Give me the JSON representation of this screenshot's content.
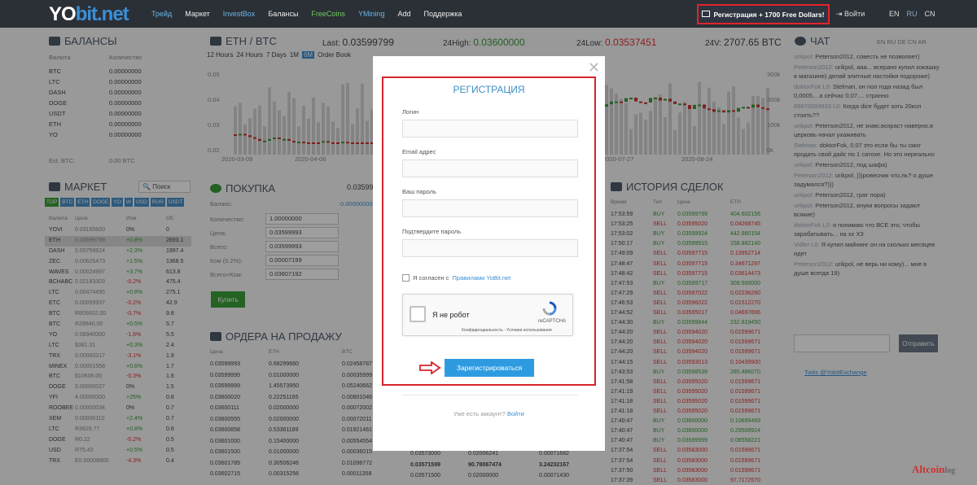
{
  "nav": {
    "logo_a": "YO",
    "logo_b": "bit.net",
    "links": [
      {
        "label": "Трейд",
        "style": "hl"
      },
      {
        "label": "Маркет",
        "style": ""
      },
      {
        "label": "InvestBox",
        "style": "hl"
      },
      {
        "label": "Балансы",
        "style": ""
      },
      {
        "label": "FreeCoins",
        "style": "gr"
      },
      {
        "label": "YMining",
        "style": "hl"
      },
      {
        "label": "Add",
        "style": ""
      },
      {
        "label": "Поддержка",
        "style": ""
      }
    ],
    "register_label": "Регистрация + 1700 Free Dollars!",
    "login_label": "Войти",
    "langs": [
      "EN",
      "RU",
      "CN"
    ]
  },
  "balances": {
    "title": "БАЛАНСЫ",
    "col_currency": "Валюта",
    "col_amount": "Количество",
    "rows": [
      {
        "cur": "BTC",
        "amt": "0.00000000"
      },
      {
        "cur": "LTC",
        "amt": "0.00000000"
      },
      {
        "cur": "DASH",
        "amt": "0.00000000"
      },
      {
        "cur": "DOGE",
        "amt": "0.00000000"
      },
      {
        "cur": "USDT",
        "amt": "0.00000000"
      },
      {
        "cur": "ETH",
        "amt": "0.00000000"
      },
      {
        "cur": "YO",
        "amt": "0.00000000"
      }
    ],
    "est_label": "Est. BTC:",
    "est_value": "0.00 BTC"
  },
  "pair": {
    "name": "ETH / BTC",
    "last_label": "Last:",
    "last": "0.03599799",
    "high_label": "24High:",
    "high": "0.03600000",
    "low_label": "24Low:",
    "low": "0.03537451",
    "vol_label": "24V:",
    "vol": "2707.65 BTC",
    "ranges": [
      "12 Hours",
      "24 Hours",
      "7 Days",
      "1M",
      "6M",
      "Order Book"
    ],
    "y_left": [
      "0.05",
      "0.04",
      "0.03",
      "0.02"
    ],
    "y_right": [
      "300k",
      "200k",
      "100k",
      "0k"
    ],
    "x_labels": [
      "2020-03-09",
      "2020-04-06",
      "2020-07-27",
      "2020-08-24"
    ]
  },
  "market": {
    "title": "МАРКЕТ",
    "search": "Поиск",
    "tabs": [
      "TOP",
      "BTC",
      "ETH",
      "DOGE",
      "YO",
      "W",
      "USD",
      "RUR",
      "USDT"
    ],
    "col_cur": "Валюта",
    "col_price": "Цена",
    "col_change": "Изм.",
    "col_vol": "Об.",
    "rows": [
      {
        "c": "YOVI",
        "p": "0.03165600",
        "ch": "0%",
        "v": "0"
      },
      {
        "c": "ETH",
        "p": "0.03599799",
        "ch": "+0.8%",
        "v": "2693.1"
      },
      {
        "c": "DASH",
        "p": "0.00759924",
        "ch": "+2.3%",
        "v": "1997.4"
      },
      {
        "c": "ZEC",
        "p": "0.00625473",
        "ch": "+1.5%",
        "v": "1368.5"
      },
      {
        "c": "WAVES",
        "p": "0.00024997",
        "ch": "+3.7%",
        "v": "613.8"
      },
      {
        "c": "BCHABC",
        "p": "0.02183303",
        "ch": "-0.2%",
        "v": "475.4"
      },
      {
        "c": "LTC",
        "p": "0.00474495",
        "ch": "+0.8%",
        "v": "275.1"
      },
      {
        "c": "ETC",
        "p": "0.00059937",
        "ch": "-0.2%",
        "v": "42.9"
      },
      {
        "c": "BTC",
        "p": "R805002.00",
        "ch": "-0.7%",
        "v": "9.8"
      },
      {
        "c": "BTC",
        "p": "R28840.00",
        "ch": "+0.5%",
        "v": "5.7"
      },
      {
        "c": "YO",
        "p": "0.08940000",
        "ch": "-1.6%",
        "v": "5.5"
      },
      {
        "c": "LTC",
        "p": "$381.31",
        "ch": "+0.3%",
        "v": "2.4"
      },
      {
        "c": "TRX",
        "p": "0.00000317",
        "ch": "-3.1%",
        "v": "1.9"
      },
      {
        "c": "MINEX",
        "p": "0.00001558",
        "ch": "+0.6%",
        "v": "1.7"
      },
      {
        "c": "BTC",
        "p": "$10606.00",
        "ch": "-0.3%",
        "v": "1.6"
      },
      {
        "c": "DOGE",
        "p": "0.00000027",
        "ch": "0%",
        "v": "1.5"
      },
      {
        "c": "YFI",
        "p": "4.00000000",
        "ch": "+25%",
        "v": "0.8"
      },
      {
        "c": "ROOBEE",
        "p": "0.00000034",
        "ch": "0%",
        "v": "0.7"
      },
      {
        "c": "XEM",
        "p": "0.00000110",
        "ch": "+2.4%",
        "v": "0.7"
      },
      {
        "c": "LTC",
        "p": "R3829.77",
        "ch": "+0.8%",
        "v": "0.6"
      },
      {
        "c": "DOGE",
        "p": "R0.22",
        "ch": "-0.2%",
        "v": "0.5"
      },
      {
        "c": "USD",
        "p": "R75.43",
        "ch": "+0.5%",
        "v": "0.5"
      },
      {
        "c": "TRX",
        "p": "E0.00008900",
        "ch": "-4.3%",
        "v": "0.4"
      }
    ]
  },
  "buy": {
    "title": "ПОКУПКА",
    "top_value": "0.03599",
    "balance_label": "Баланс:",
    "balance_value": "0.00000000",
    "fields": [
      {
        "label": "Количество:",
        "value": "1.00000000"
      },
      {
        "label": "Цена:",
        "value": "0.03599993"
      },
      {
        "label": "Всего:",
        "value": "0.03599993"
      },
      {
        "label": "Ком (0.2%):",
        "value": "0.00007199"
      },
      {
        "label": "Всего+Ком:",
        "value": "0.03607192"
      }
    ],
    "button": "Купить"
  },
  "sell_orders": {
    "title": "ОРДЕРА НА ПРОДАЖУ",
    "cols": [
      "Цена",
      "ETH",
      "BTC"
    ],
    "rows": [
      [
        "0.03599993",
        "0.68299660",
        "0.02458787"
      ],
      [
        "0.03599995",
        "0.01000000",
        "0.00035999"
      ],
      [
        "0.03599999",
        "1.45573950",
        "0.05240662"
      ],
      [
        "0.03600020",
        "0.22251165",
        "0.00801046"
      ],
      [
        "0.03600111",
        "0.02000000",
        "0.00072002"
      ],
      [
        "0.03600555",
        "0.02000000",
        "0.00072011"
      ],
      [
        "0.03600858",
        "0.53361189",
        "0.01921461"
      ],
      [
        "0.03601000",
        "0.15400000",
        "0.00554554"
      ],
      [
        "0.03601500",
        "0.01000000",
        "0.00036015"
      ],
      [
        "0.03601785",
        "0.30506246",
        "0.01098772"
      ],
      [
        "0.03602715",
        "0.00315256",
        "0.00011358"
      ]
    ]
  },
  "buy_orders_tail": [
    [
      "0.03573000",
      "0.02006241",
      "0.00071682"
    ],
    [
      "0.03571599",
      "90.78067474",
      "3.24232167"
    ],
    [
      "0.03571500",
      "0.02000000",
      "0.00071430"
    ]
  ],
  "history": {
    "title": "ИСТОРИЯ СДЕЛОК",
    "cols": [
      "Время",
      "Тип",
      "Цена",
      "ETH"
    ],
    "rows": [
      [
        "17:53:59",
        "BUY",
        "0.03599799",
        "404.602156"
      ],
      [
        "17:53:25",
        "SELL",
        "0.03595020",
        "0.04268745"
      ],
      [
        "17:53:02",
        "BUY",
        "0.03599924",
        "442.980154"
      ],
      [
        "17:50:17",
        "BUY",
        "0.03599915",
        "158.882140"
      ],
      [
        "17:49:09",
        "SELL",
        "0.03597715",
        "0.13952714"
      ],
      [
        "17:48:47",
        "SELL",
        "0.03597715",
        "0.34671297"
      ],
      [
        "17:48:42",
        "SELL",
        "0.03597715",
        "0.03614473"
      ],
      [
        "17:47:53",
        "BUY",
        "0.03599717",
        "309.500000"
      ],
      [
        "17:47:29",
        "SELL",
        "0.03597022",
        "0.02236260"
      ],
      [
        "17:46:53",
        "SELL",
        "0.03596022",
        "0.01512270"
      ],
      [
        "17:44:52",
        "SELL",
        "0.03595017",
        "0.04697696"
      ],
      [
        "17:44:30",
        "BUY",
        "0.03599844",
        "232.819450"
      ],
      [
        "17:44:20",
        "SELL",
        "0.03594020",
        "0.01599671"
      ],
      [
        "17:44:20",
        "SELL",
        "0.03594020",
        "0.01599671"
      ],
      [
        "17:44:20",
        "SELL",
        "0.03594020",
        "0.01599671"
      ],
      [
        "17:44:15",
        "SELL",
        "0.03593013",
        "0.10439900"
      ],
      [
        "17:43:53",
        "BUY",
        "0.03598539",
        "285.486070"
      ],
      [
        "17:41:58",
        "SELL",
        "0.03595020",
        "0.01599671"
      ],
      [
        "17:41:19",
        "SELL",
        "0.03595020",
        "0.01599671"
      ],
      [
        "17:41:18",
        "SELL",
        "0.03595020",
        "0.01599671"
      ],
      [
        "17:41:18",
        "SELL",
        "0.03595020",
        "0.01599671"
      ],
      [
        "17:40:47",
        "BUY",
        "0.03600000",
        "0.10699469"
      ],
      [
        "17:40:47",
        "BUY",
        "0.03600000",
        "0.29508924"
      ],
      [
        "17:40:47",
        "BUY",
        "0.03599999",
        "0.06558221"
      ],
      [
        "17:37:54",
        "SELL",
        "0.03583000",
        "0.01599671"
      ],
      [
        "17:37:54",
        "SELL",
        "0.03583000",
        "0.01599671"
      ],
      [
        "17:37:50",
        "SELL",
        "0.03583000",
        "0.01599671"
      ],
      [
        "17:37:39",
        "SELL",
        "0.03583000",
        "97.7172570"
      ]
    ]
  },
  "chat": {
    "title": "ЧАТ",
    "langs": "EN RU DE CN AR",
    "messages": [
      {
        "user": "urikpol:",
        "text": "Peterson2012, совесть не позволяет)"
      },
      {
        "user": "Peterson2012:",
        "text": "urikpol, ааа... всерано купил кокашку в магазине) делай элитные настойки подороже)"
      },
      {
        "user": "doktorFok L0:",
        "text": "Stelman, он пол года назад был 0,0005... а сейчас 0,07.... странно"
      },
      {
        "user": "89670599933 L0:",
        "text": "Когда dice будет хоть 20кол стоить??"
      },
      {
        "user": "urikpol:",
        "text": "Peterson2012, не знаю,возраст наверно,в церковь начал ухаживать"
      },
      {
        "user": "Stelman:",
        "text": "doktorFok, 0.07 это если бы ты смог продать свой дайс по 1 сатохе. Но это нереально"
      },
      {
        "user": "urikpol:",
        "text": "Peterson2012, под шафа)"
      },
      {
        "user": "Peterson2012:",
        "text": "urikpol, )))ровесник что,ль? о душе задумался?)))"
      },
      {
        "user": "urikpol:",
        "text": "Peterson2012, грат пора)"
      },
      {
        "user": "urikpol:",
        "text": "Peterson2012, внуки вопросы задают всякие)"
      },
      {
        "user": "doktorFok L0:",
        "text": "я понимаю что ВСЕ это, чтобы зарабатывать... на хх ХЗ"
      },
      {
        "user": "Vidler L0:",
        "text": "Я купил майнинг он на сколько месяцев идет"
      },
      {
        "user": "Peterson2012:",
        "text": "urikpol, не верь ни кому)... мне в душе всегда 19)"
      }
    ],
    "send": "Отправить",
    "twitter": "Twits @YobitExchange"
  },
  "modal": {
    "title": "РЕГИСТРАЦИЯ",
    "login_label": "Логин",
    "email_label": "Email адрес",
    "password_label": "Ваш пароль",
    "confirm_label": "Подтвердите пароль",
    "agree_text": "Я согласен с",
    "agree_link": "Правилами YoBit.net",
    "captcha_text": "Я не робот",
    "captcha_brand": "reCAPTCHA",
    "captcha_privacy": "Конфиденциальность - Условия использования",
    "submit": "Зарегистрироваться",
    "already_text": "Уже есть аккаунт?",
    "already_link": "Войти"
  },
  "watermark": {
    "a": "Altcoin",
    "b": "log"
  },
  "colors": {
    "accent": "#2e9be0",
    "highlight_border": "#e2242c",
    "buy": "#3a9a3a",
    "sell": "#dd3333"
  }
}
